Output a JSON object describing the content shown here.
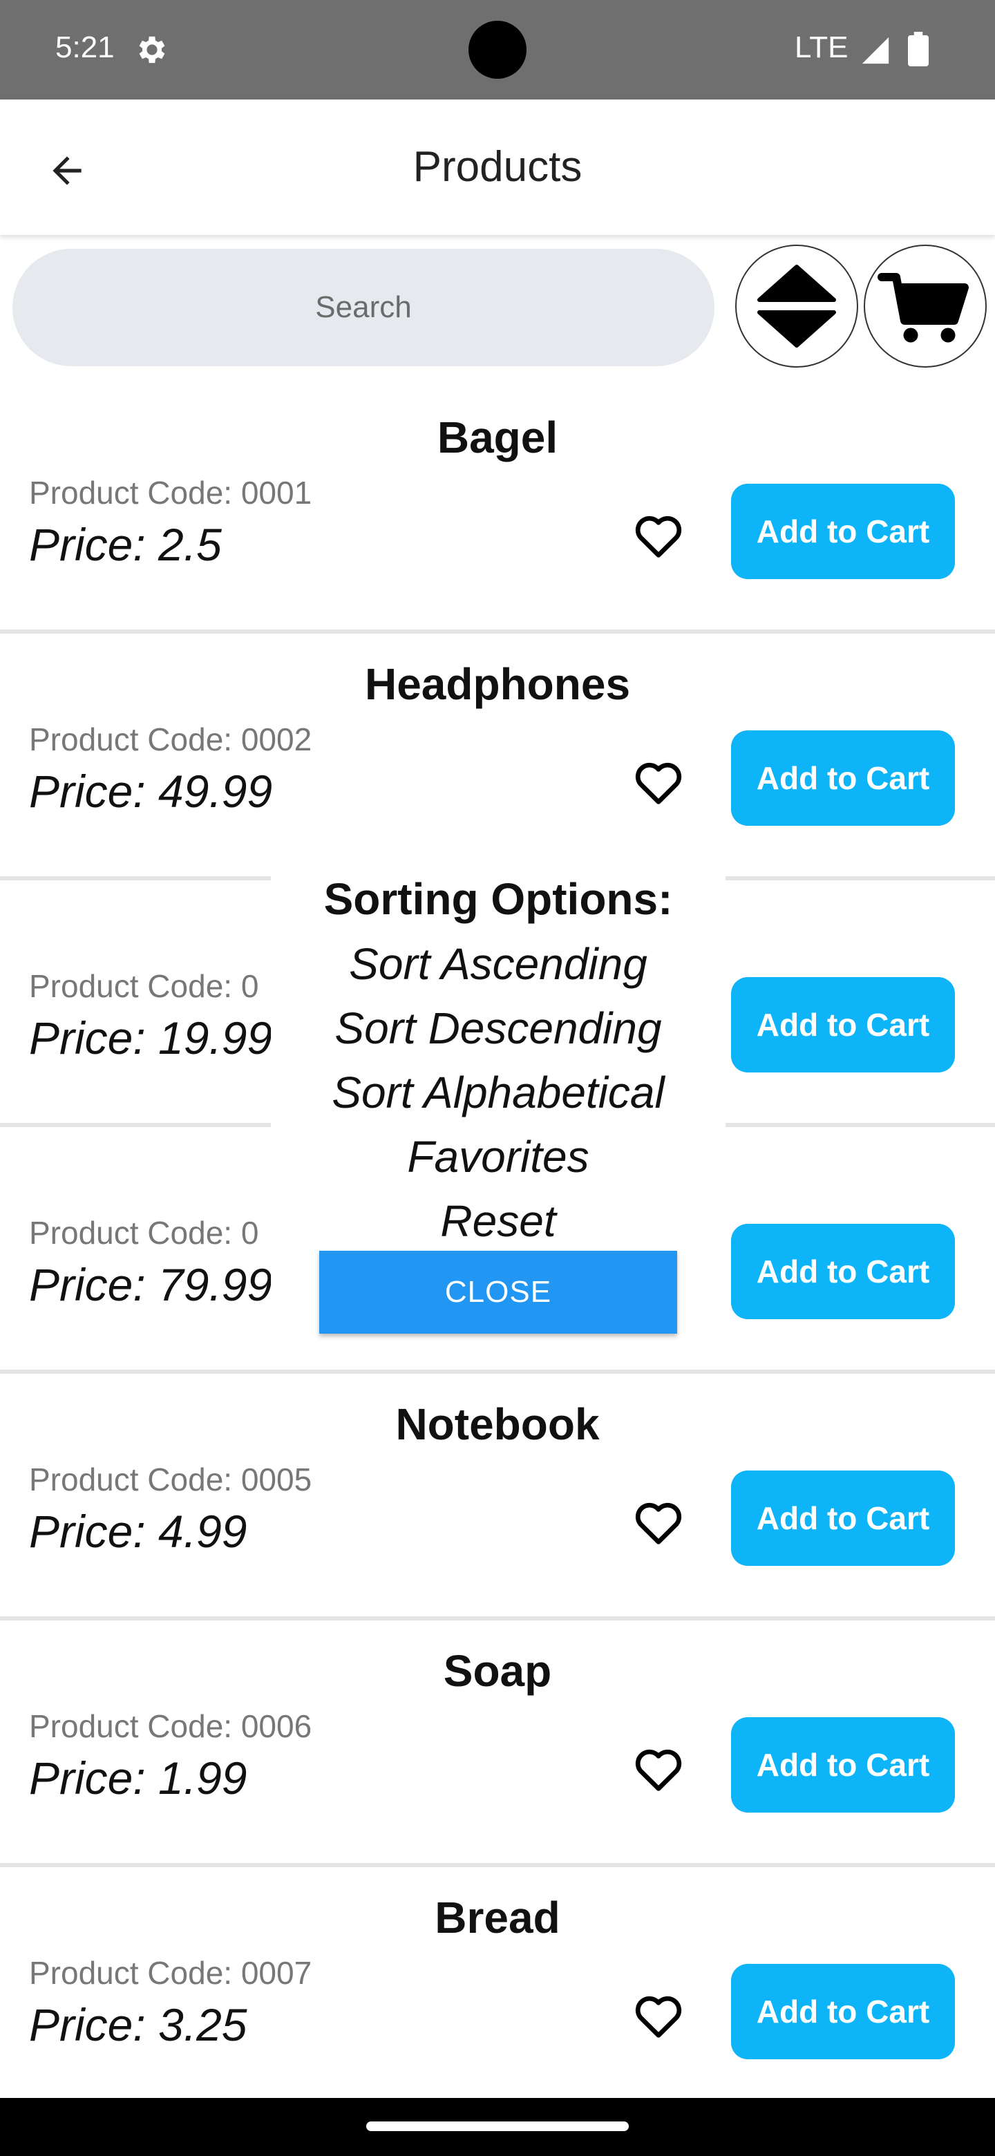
{
  "status_bar": {
    "time": "5:21",
    "network": "LTE",
    "icons": [
      "gear-icon",
      "signal-icon",
      "battery-icon"
    ]
  },
  "app_bar": {
    "title": "Products",
    "back_icon": "arrow-left-icon"
  },
  "search": {
    "placeholder": "Search",
    "value": ""
  },
  "toolbar": {
    "sort_icon": "sort-up-down-icon",
    "cart_icon": "shopping-cart-icon"
  },
  "products": [
    {
      "name": "Bagel",
      "code": "Product Code: 0001",
      "price": "Price: 2.5",
      "add_label": "Add to Cart"
    },
    {
      "name": "Headphones",
      "code": "Product Code: 0002",
      "price": "Price: 49.99",
      "add_label": "Add to Cart"
    },
    {
      "name": "",
      "code": "Product Code: 0",
      "price": "Price: 19.99",
      "add_label": "Add to Cart"
    },
    {
      "name": "",
      "code": "Product Code: 0",
      "price": "Price: 79.99",
      "add_label": "Add to Cart"
    },
    {
      "name": "Notebook",
      "code": "Product Code: 0005",
      "price": "Price: 4.99",
      "add_label": "Add to Cart"
    },
    {
      "name": "Soap",
      "code": "Product Code: 0006",
      "price": "Price: 1.99",
      "add_label": "Add to Cart"
    },
    {
      "name": "Bread",
      "code": "Product Code: 0007",
      "price": "Price: 3.25",
      "add_label": "Add to Cart"
    }
  ],
  "sort_dialog": {
    "title": "Sorting Options:",
    "options": [
      "Sort Ascending",
      "Sort Descending",
      "Sort Alphabetical",
      "Favorites",
      "Reset"
    ],
    "close_label": "CLOSE"
  },
  "colors": {
    "status_bar": "#6f6f6f",
    "add_button": "#0db4f7",
    "close_button": "#2196f3",
    "search_bg": "#e6e9ed"
  }
}
